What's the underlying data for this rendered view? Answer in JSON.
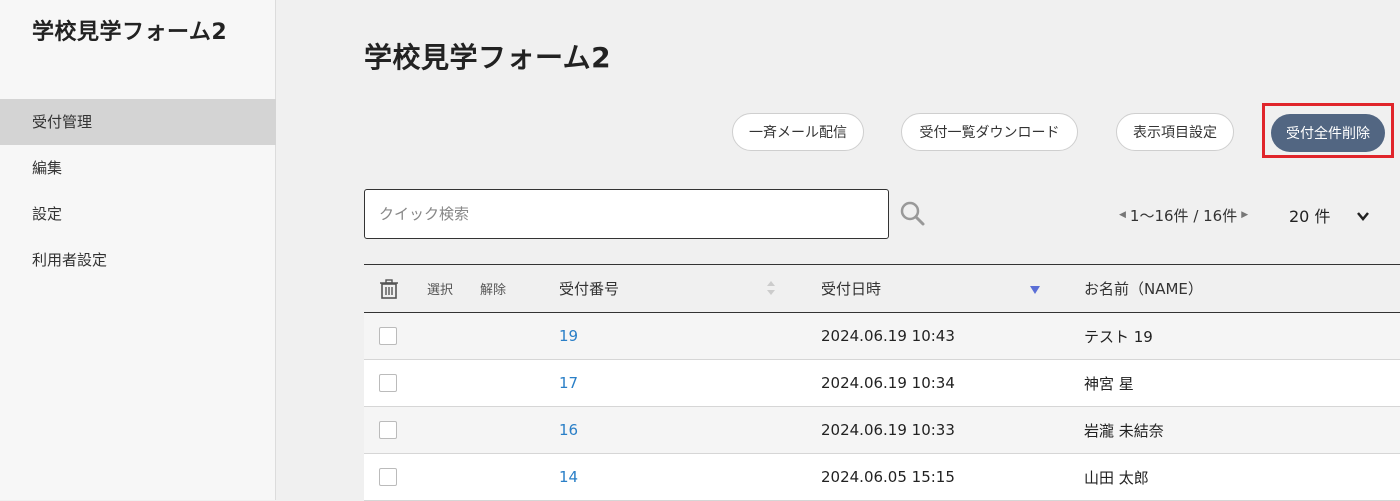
{
  "sidebar": {
    "app_title": "学校見学フォーム2",
    "items": [
      {
        "label": "受付管理",
        "active": true
      },
      {
        "label": "編集"
      },
      {
        "label": "設定"
      },
      {
        "label": "利用者設定"
      }
    ]
  },
  "main": {
    "page_title": "学校見学フォーム2",
    "buttons": {
      "mail": "一斉メール配信",
      "download": "受付一覧ダウンロード",
      "columns": "表示項目設定",
      "delete_all": "受付全件削除"
    },
    "search": {
      "placeholder": "クイック検索",
      "value": ""
    },
    "pager": {
      "range": "1〜16件 / 16件"
    },
    "per_page": "20 件",
    "table": {
      "headers": {
        "select": "選択",
        "deselect": "解除",
        "id": "受付番号",
        "date": "受付日時",
        "name": "お名前（NAME）"
      },
      "rows": [
        {
          "id": "19",
          "date": "2024.06.19 10:43",
          "name": "テスト 19"
        },
        {
          "id": "17",
          "date": "2024.06.19 10:34",
          "name": "神宮 星"
        },
        {
          "id": "16",
          "date": "2024.06.19 10:33",
          "name": "岩瀧 未結奈"
        },
        {
          "id": "14",
          "date": "2024.06.05 15:15",
          "name": "山田 太郎"
        }
      ]
    }
  },
  "colors": {
    "accent": "#526682",
    "highlight": "#e0252b",
    "link": "#2a7fc7",
    "sort_active": "#5b6fd6"
  }
}
